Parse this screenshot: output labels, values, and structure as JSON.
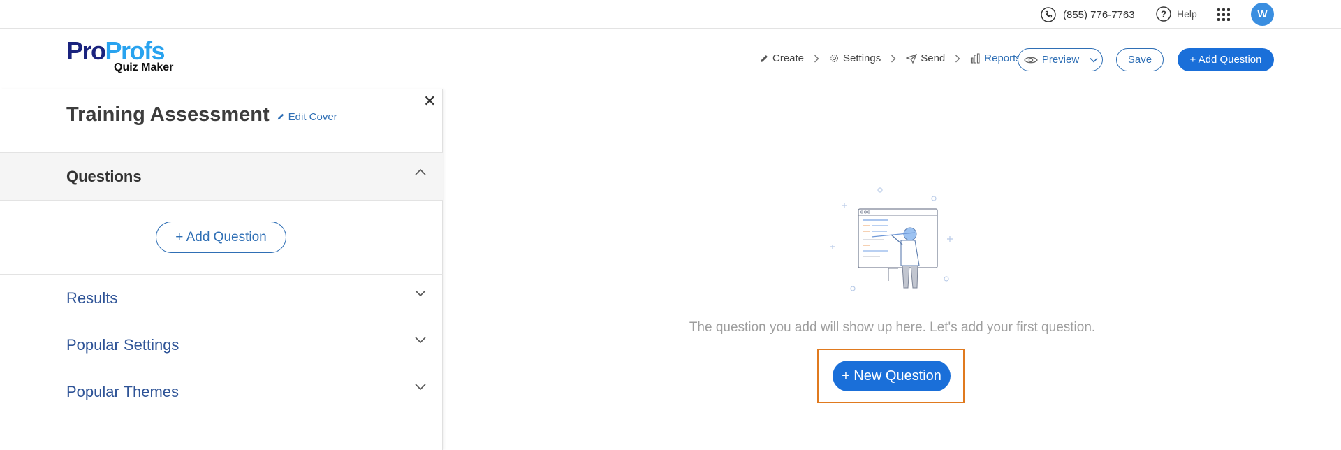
{
  "topbar": {
    "phone": "(855) 776-7763",
    "help": "Help",
    "avatar_initial": "W"
  },
  "header": {
    "logo_pro": "Pro",
    "logo_profs": "Profs",
    "logo_sub": "Quiz Maker",
    "steps": [
      {
        "label": "Create",
        "icon": "pencil-icon"
      },
      {
        "label": "Settings",
        "icon": "gear-icon"
      },
      {
        "label": "Send",
        "icon": "paper-plane-icon"
      },
      {
        "label": "Reports",
        "icon": "bar-chart-icon"
      }
    ],
    "preview_label": "Preview",
    "save_label": "Save",
    "add_question_label": "+ Add Question"
  },
  "sidebar": {
    "close_glyph": "✕",
    "quiz_title": "Training Assessment",
    "edit_cover_label": "Edit Cover",
    "sections": {
      "questions": "Questions",
      "add_question": "+ Add Question",
      "results": "Results",
      "popular_settings": "Popular Settings",
      "popular_themes": "Popular Themes"
    }
  },
  "main": {
    "empty_message": "The question you add will show up here. Let's add your first question.",
    "new_question_label": "+ New Question"
  },
  "colors": {
    "primary": "#1a6fd9",
    "link": "#2f6fb5",
    "highlight": "#e07a1f",
    "avatar": "#3a8ee0"
  }
}
